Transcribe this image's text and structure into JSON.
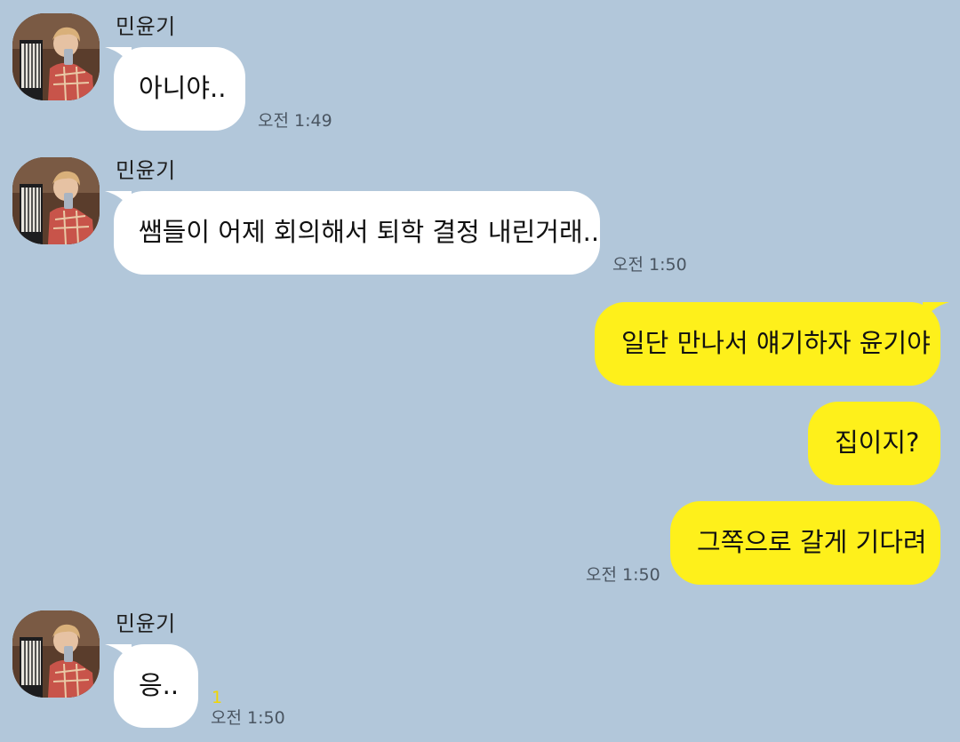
{
  "messages": {
    "m1": {
      "sender": "민윤기",
      "text": "아니야..",
      "time": "오전 1:49"
    },
    "m2": {
      "sender": "민윤기",
      "text": "쌤들이 어제 회의해서 퇴학 결정 내린거래..",
      "time": "오전 1:50"
    },
    "m3": {
      "text": "일단 만나서 얘기하자 윤기야"
    },
    "m4": {
      "text": "집이지?"
    },
    "m5": {
      "text": "그쪽으로 갈게 기다려",
      "time": "오전 1:50"
    },
    "m6": {
      "sender": "민윤기",
      "text": "응..",
      "unread": "1",
      "time": "오전 1:50"
    }
  },
  "colors": {
    "background": "#b2c7da",
    "incoming_bubble": "#ffffff",
    "outgoing_bubble": "#fef01b",
    "unread_count": "#f2d600"
  },
  "icons": {
    "avatar": "profile-photo"
  }
}
